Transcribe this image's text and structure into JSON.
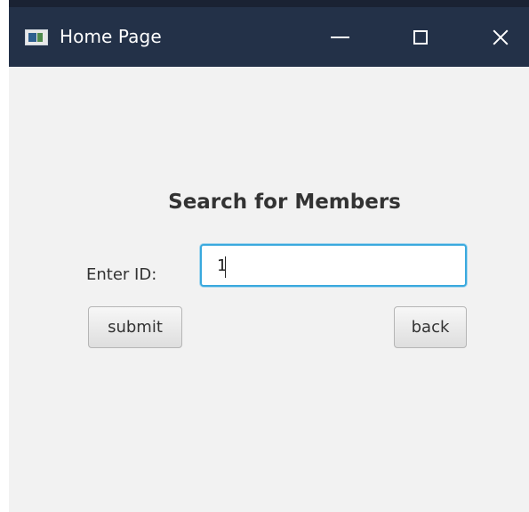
{
  "window": {
    "title": "Home Page",
    "icon": "java-app-icon",
    "controls": {
      "minimize": "minimize-icon",
      "maximize": "maximize-icon",
      "close": "close-icon"
    },
    "titlebar_color": "#233148"
  },
  "form": {
    "heading": "Search for Members",
    "id_label": "Enter ID:",
    "id_value": "1",
    "submit_label": "submit",
    "back_label": "back",
    "focus_color": "#3aa9de"
  }
}
